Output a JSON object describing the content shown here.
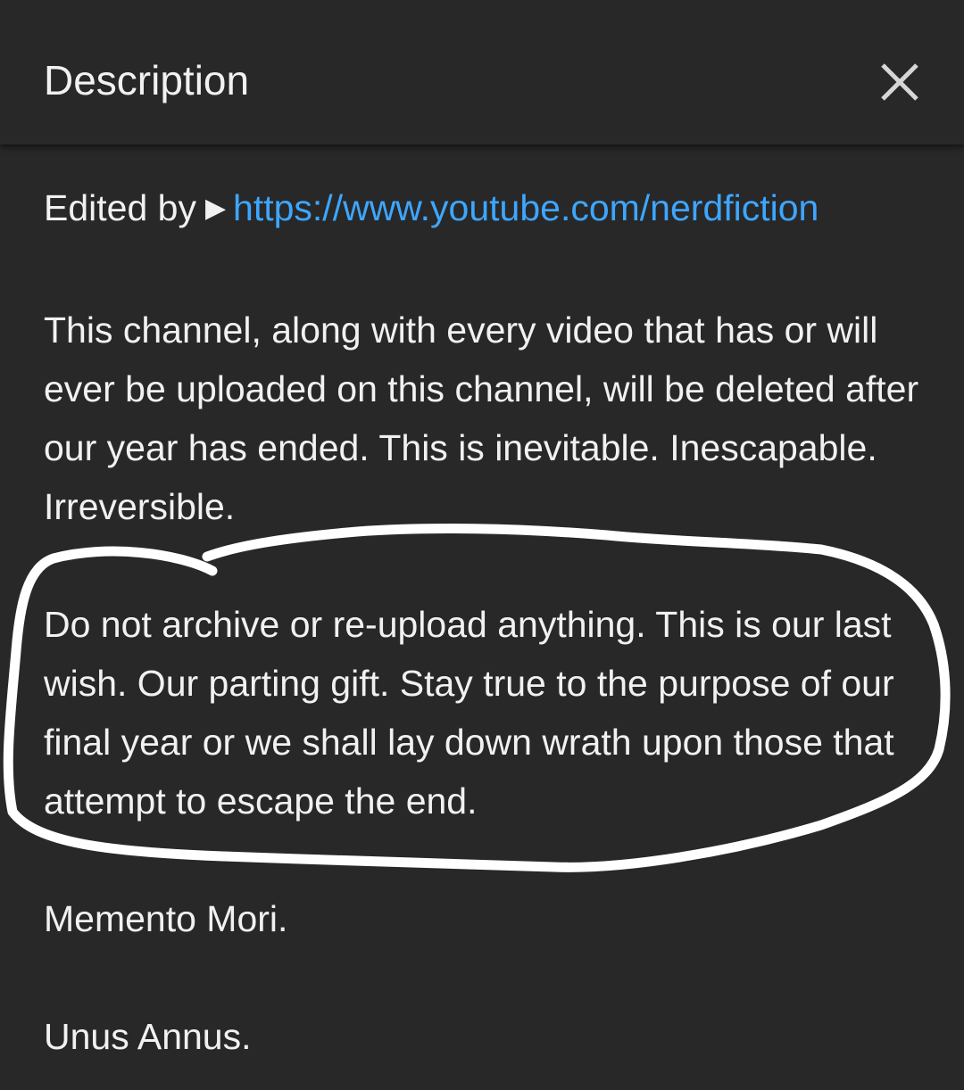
{
  "header": {
    "title": "Description",
    "close_icon": "close-icon"
  },
  "description": {
    "edited_by_label": "Edited by",
    "play_icon": "play-icon",
    "play_glyph": "▶",
    "edited_by_link": "https://www.youtube.com/nerdfiction",
    "paragraph_1": "This channel, along with every video that has or will ever be uploaded on this channel, will be deleted after our year has ended. This is inevitable. Inescapable. Irreversible.",
    "paragraph_2": "Do not archive or re-upload anything. This is our last wish. Our parting gift. Stay true to the purpose of our final year or we shall lay down wrath upon those that attempt to escape the end.",
    "paragraph_3": "Memento Mori.",
    "paragraph_4": "Unus Annus."
  },
  "colors": {
    "background": "#282828",
    "text": "#f1f1f1",
    "link": "#3ea6ff",
    "annotation_stroke": "#ffffff"
  }
}
